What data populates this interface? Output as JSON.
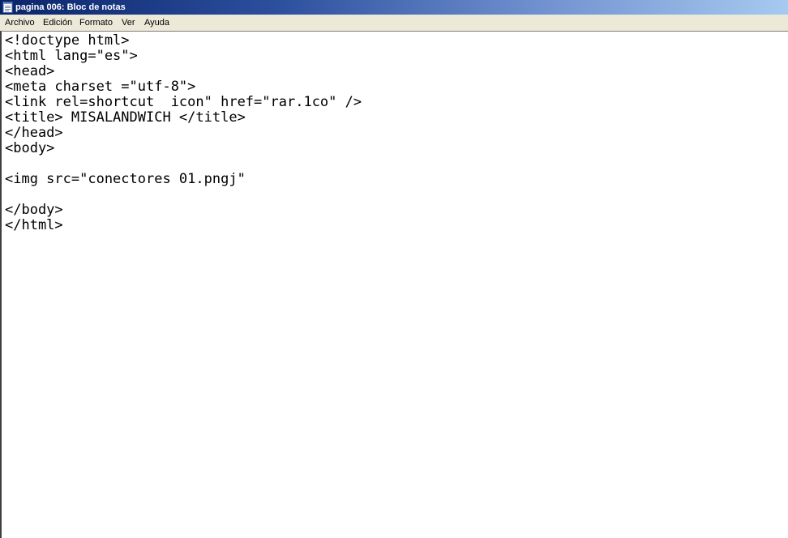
{
  "window": {
    "title": "pagina 006: Bloc de notas",
    "icon": "notepad-icon"
  },
  "menu": {
    "items": [
      "Archivo",
      "Edición",
      "Formato",
      "Ver",
      "Ayuda"
    ]
  },
  "editor": {
    "content": "<!doctype html>\n<html lang=\"es\">\n<head>\n<meta charset =\"utf-8\">\n<link rel=shortcut  icon\" href=\"rar.1co\" />\n<title> MISALANDWICH </title>\n</head>\n<body>\n\n<img src=\"conectores 01.pngj\"\n\n</body>\n</html>"
  }
}
